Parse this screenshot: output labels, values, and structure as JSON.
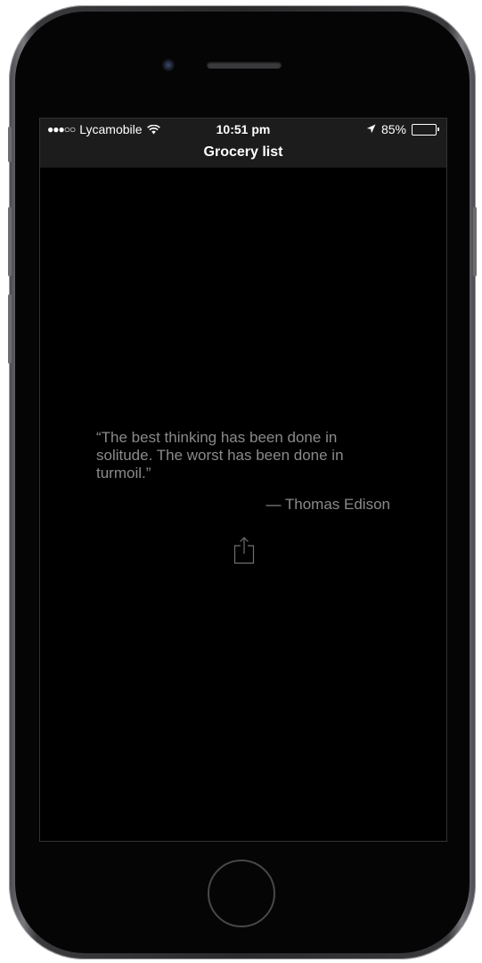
{
  "status_bar": {
    "signal_dots": "●●●○○",
    "carrier": "Lycamobile",
    "time": "10:51 pm",
    "battery_percent": "85%",
    "battery_level": 0.85
  },
  "nav": {
    "title": "Grocery list"
  },
  "quote": {
    "text": "“The best thinking has been done in solitude. The worst has been done in turmoil.”",
    "author": "— Thomas Edison"
  },
  "icons": {
    "wifi": "wifi-icon",
    "location": "location-arrow-icon",
    "battery": "battery-icon",
    "share": "share-icon"
  }
}
